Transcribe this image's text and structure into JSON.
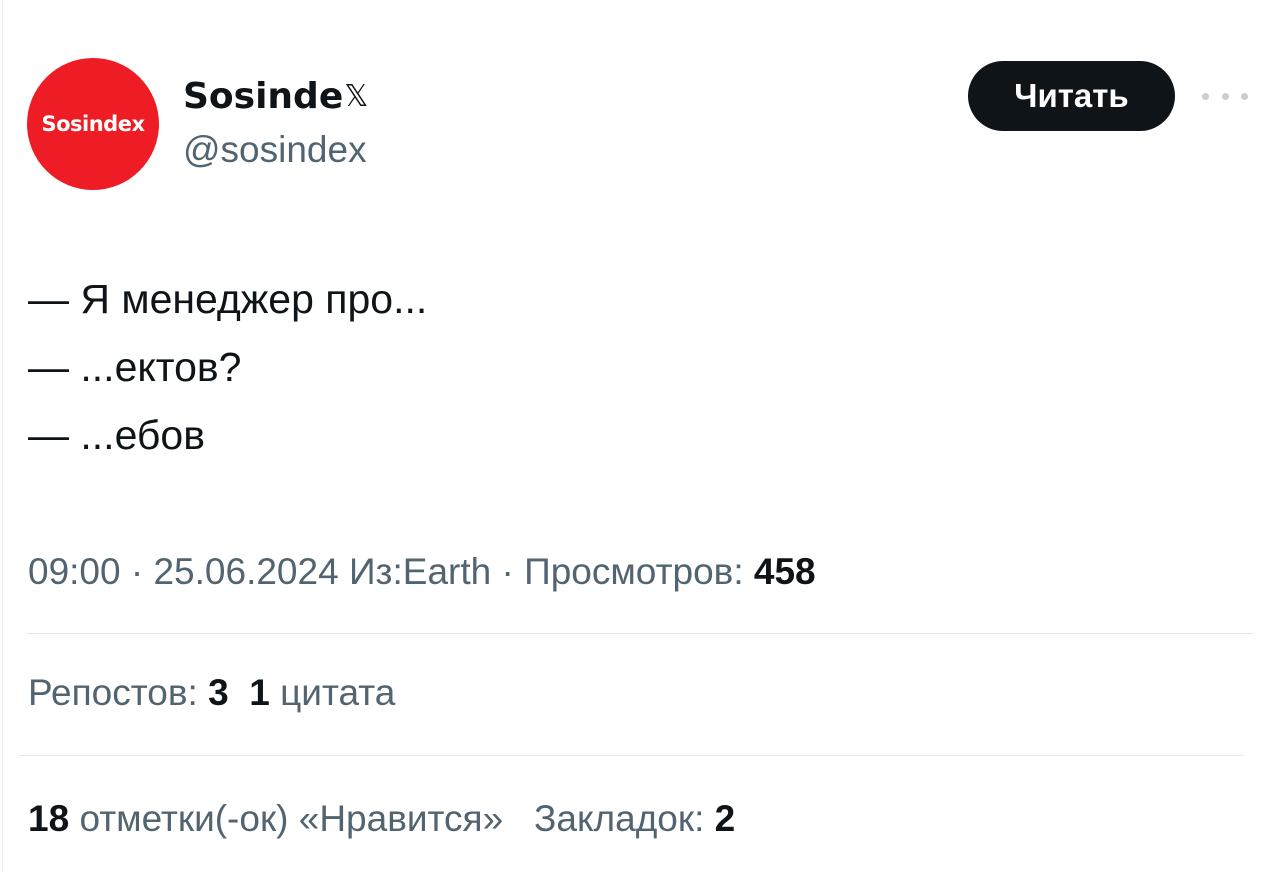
{
  "author": {
    "display_name": "Sosinde",
    "display_name_suffix": "𝕏",
    "handle": "@sosindex",
    "avatar_text": "Sosindex",
    "avatar_color": "#ee1c25"
  },
  "actions": {
    "read_label": "Читать",
    "more_icon": "more-horizontal-icon"
  },
  "tweet": {
    "lines": [
      "— Я менеджер про...",
      "— ...ектов?",
      "— ...ебов"
    ]
  },
  "meta": {
    "time": "09:00",
    "separator": "·",
    "date": "25.06.2024",
    "location": "Из:Earth",
    "views_label": "Просмотров:",
    "views_count": "458"
  },
  "stats": {
    "reposts_label": "Репостов:",
    "reposts_count": "3",
    "quotes_count": "1",
    "quotes_label": "цитата",
    "likes_count": "18",
    "likes_label": "отметки(-ок) «Нравится»",
    "bookmarks_label": "Закладок:",
    "bookmarks_count": "2"
  },
  "colors": {
    "text_primary": "#0f1419",
    "text_secondary": "#536471",
    "button_bg": "#0f1419",
    "divider": "#e3e8ea"
  }
}
